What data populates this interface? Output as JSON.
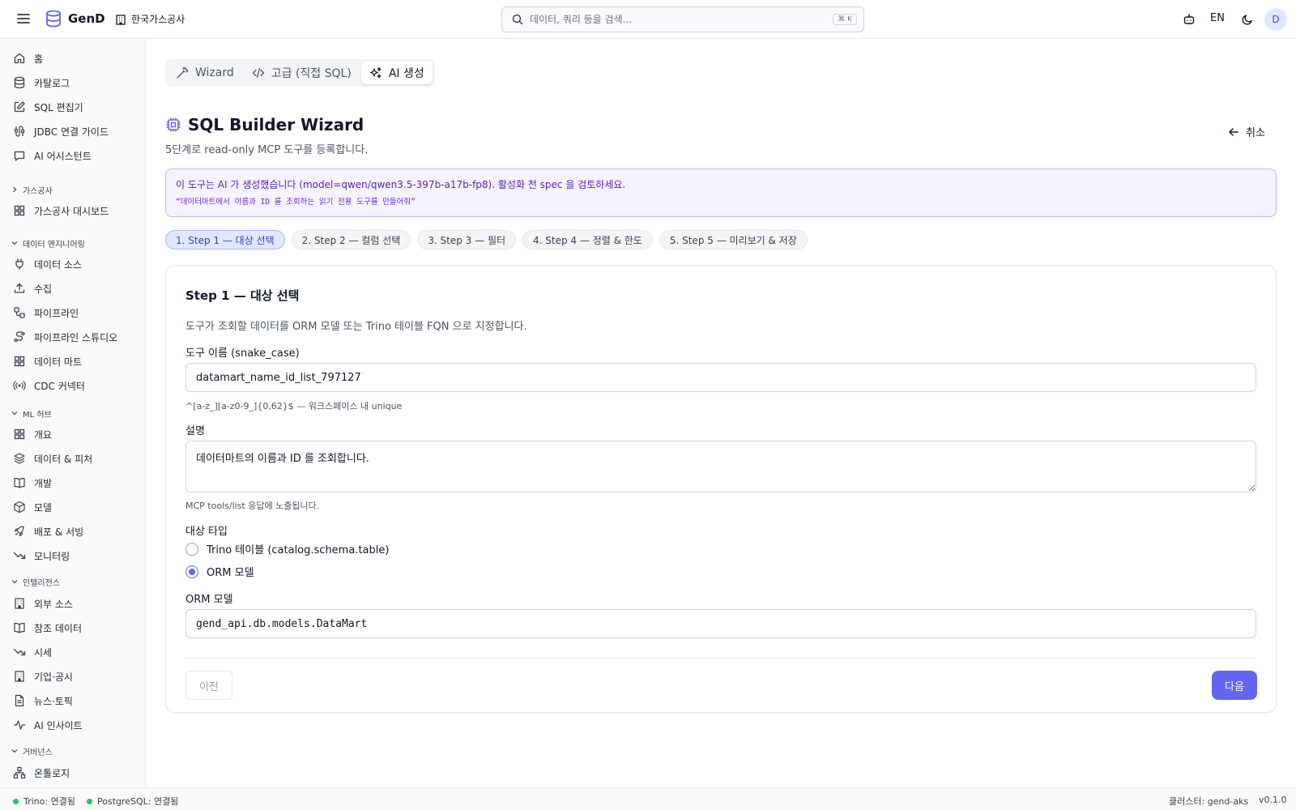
{
  "header": {
    "brand": "GenD",
    "org": "한국가스공사",
    "search_placeholder": "데이터, 쿼리 등을 검색...",
    "search_shortcut": "⌘ K",
    "lang": "EN",
    "avatar": "D"
  },
  "sidebar": {
    "top_items": [
      {
        "label": "홈",
        "icon": "home-icon"
      },
      {
        "label": "카탈로그",
        "icon": "database-icon"
      },
      {
        "label": "SQL 편집기",
        "icon": "edit-icon"
      },
      {
        "label": "JDBC 연결 가이드",
        "icon": "cable-icon"
      },
      {
        "label": "AI 어시스턴트",
        "icon": "chat-icon"
      }
    ],
    "sections": [
      {
        "title": "가스공사",
        "collapsed": true,
        "items": [
          {
            "label": "가스공사 대시보드",
            "icon": "grid-icon"
          }
        ]
      },
      {
        "title": "데이터 엔지니어링",
        "collapsed": false,
        "items": [
          {
            "label": "데이터 소스",
            "icon": "plug-icon"
          },
          {
            "label": "수집",
            "icon": "upload-icon"
          },
          {
            "label": "파이프라인",
            "icon": "workflow-icon"
          },
          {
            "label": "파이프라인 스튜디오",
            "icon": "route-icon"
          },
          {
            "label": "데이터 마트",
            "icon": "grid-icon"
          },
          {
            "label": "CDC 커넥터",
            "icon": "broadcast-icon"
          }
        ]
      },
      {
        "title": "ML 허브",
        "collapsed": false,
        "items": [
          {
            "label": "개요",
            "icon": "grid-icon"
          },
          {
            "label": "데이터 & 피처",
            "icon": "layers-icon"
          },
          {
            "label": "개발",
            "icon": "book-icon"
          },
          {
            "label": "모델",
            "icon": "box-icon"
          },
          {
            "label": "배포 & 서빙",
            "icon": "rocket-icon"
          },
          {
            "label": "모니터링",
            "icon": "trend-down-icon"
          }
        ]
      },
      {
        "title": "인텔리전스",
        "collapsed": false,
        "items": [
          {
            "label": "외부 소스",
            "icon": "building-icon"
          },
          {
            "label": "참조 데이터",
            "icon": "book-icon"
          },
          {
            "label": "시세",
            "icon": "trend-down-icon"
          },
          {
            "label": "기업·공시",
            "icon": "building-icon"
          },
          {
            "label": "뉴스·토픽",
            "icon": "document-icon"
          },
          {
            "label": "AI 인사이트",
            "icon": "activity-icon"
          }
        ]
      },
      {
        "title": "거버넌스",
        "collapsed": false,
        "items": [
          {
            "label": "온톨로지",
            "icon": "network-icon"
          }
        ]
      }
    ]
  },
  "mode_tabs": [
    {
      "label": "Wizard",
      "icon": "wand-icon",
      "active": false
    },
    {
      "label": "고급 (직접 SQL)",
      "icon": "code-icon",
      "active": false
    },
    {
      "label": "AI 생성",
      "icon": "sparkles-icon",
      "active": true
    }
  ],
  "page": {
    "title": "SQL Builder Wizard",
    "subtitle": "5단계로 read-only MCP 도구를 등록합니다.",
    "cancel_label": "취소"
  },
  "ai_banner": {
    "line1": "이 도구는 AI 가 생성했습니다 (model=qwen/qwen3.5-397b-a17b-fp8). 활성화 전 spec 을 검토하세요.",
    "line2": "“데이터마트에서 이름과 ID 를 조회하는 읽기 전용 도구를 만들어줘”"
  },
  "steps": [
    {
      "label": "1. Step 1 — 대상 선택",
      "active": true
    },
    {
      "label": "2. Step 2 — 컬럼 선택",
      "active": false
    },
    {
      "label": "3. Step 3 — 필터",
      "active": false
    },
    {
      "label": "4. Step 4 — 정렬 & 한도",
      "active": false
    },
    {
      "label": "5. Step 5 — 미리보기 & 저장",
      "active": false
    }
  ],
  "step1": {
    "title": "Step 1 — 대상 선택",
    "description": "도구가 조회할 데이터를 ORM 모델 또는 Trino 테이블 FQN 으로 지정합니다.",
    "tool_name_label": "도구 이름 (snake_case)",
    "tool_name_value": "datamart_name_id_list_797127",
    "tool_name_help": "^[a-z_][a-z0-9_]{0,62}$ — 워크스페이스 내 unique",
    "desc_label": "설명",
    "desc_value": "데이터마트의 이름과 ID 를 조회합니다.",
    "desc_help": "MCP tools/list 응답에 노출됩니다.",
    "target_type_label": "대상 타입",
    "target_options": [
      {
        "label": "Trino 테이블 (catalog.schema.table)",
        "checked": false
      },
      {
        "label": "ORM 모델",
        "checked": true
      }
    ],
    "orm_label": "ORM 모델",
    "orm_value": "gend_api.db.models.DataMart",
    "prev_label": "이전",
    "next_label": "다음"
  },
  "statusbar": {
    "trino": "Trino: 연결됨",
    "postgres": "PostgreSQL: 연결됨",
    "cluster": "클러스터: gend-aks",
    "version": "v0.1.0"
  },
  "colors": {
    "accent": "#6366f1",
    "banner_bg": "#f5f3ff",
    "status_ok": "#22c55e"
  }
}
